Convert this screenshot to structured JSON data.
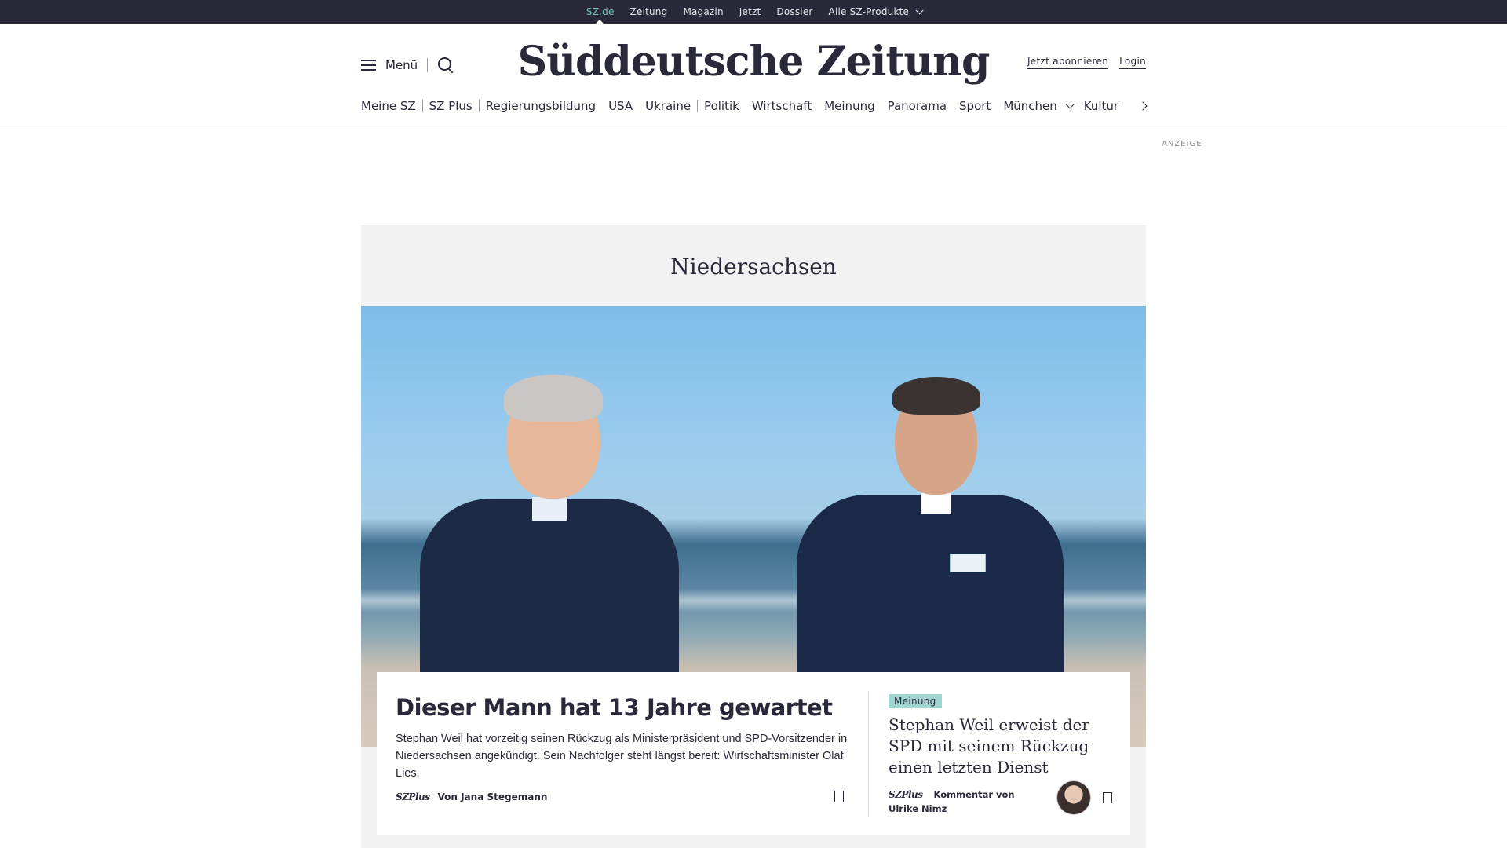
{
  "topbar": {
    "items": [
      "SZ.de",
      "Zeitung",
      "Magazin",
      "Jetzt",
      "Dossier",
      "Alle SZ-Produkte"
    ]
  },
  "header": {
    "menu_label": "Menü",
    "logo": "Süddeutsche Zeitung",
    "subscribe": "Jetzt abonnieren",
    "login": "Login"
  },
  "nav": {
    "items": [
      "Meine SZ",
      "SZ Plus",
      "Regierungsbildung",
      "USA",
      "Ukraine",
      "Politik",
      "Wirtschaft",
      "Meinung",
      "Panorama",
      "Sport",
      "München",
      "Kultur"
    ]
  },
  "ad_label": "ANZEIGE",
  "section": {
    "title": "Niedersachsen"
  },
  "lead": {
    "headline": "Dieser Mann hat 13 Jahre gewartet",
    "text": "Stephan Weil hat vorzeitig seinen Rückzug als Ministerpräsident und SPD-Vorsitzender in Niedersachsen angekündigt. Sein Nachfolger steht längst bereit: Wirtschaftsminister Olaf Lies.",
    "brand": "SZPlus",
    "byline": "Von Jana Stegemann"
  },
  "opinion": {
    "tag": "Meinung",
    "headline": "Stephan Weil erweist der SPD mit seinem Rückzug einen letzten Dienst",
    "brand": "SZPlus",
    "byline": "Kommentar von Ulrike Nimz"
  },
  "colors": {
    "dark": "#29293a",
    "accent_teal": "#71c3be",
    "meinung_tag": "#9fd6cf",
    "section_bg": "#f2f2f2"
  }
}
